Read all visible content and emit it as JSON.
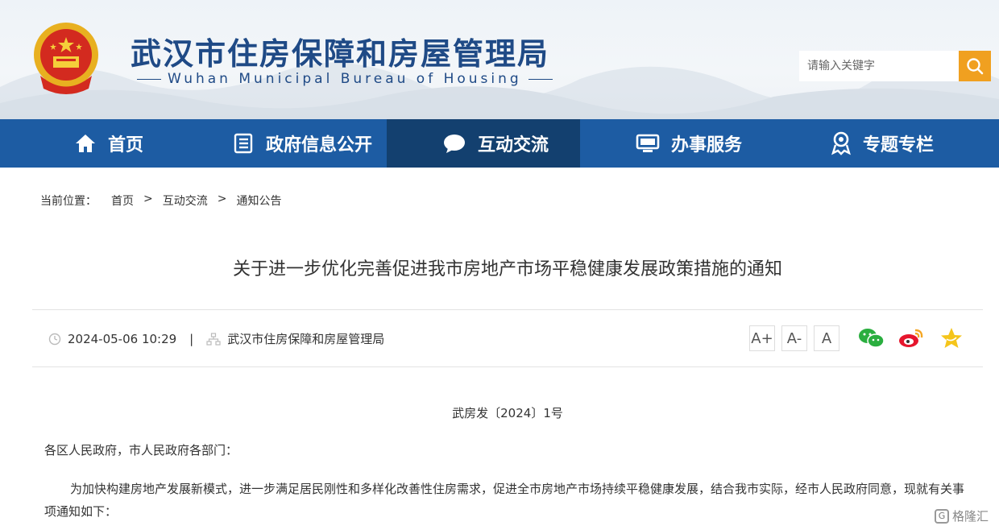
{
  "header": {
    "title": "武汉市住房保障和房屋管理局",
    "subtitle": "Wuhan Municipal Bureau of Housing",
    "search_placeholder": "请输入关键字"
  },
  "nav": {
    "items": [
      {
        "label": "首页",
        "icon": "home-icon"
      },
      {
        "label": "政府信息公开",
        "icon": "document-list-icon"
      },
      {
        "label": "互动交流",
        "icon": "chat-bubble-icon",
        "active": true
      },
      {
        "label": "办事服务",
        "icon": "monitor-icon"
      },
      {
        "label": "专题专栏",
        "icon": "location-pin-icon"
      }
    ]
  },
  "breadcrumb": {
    "prefix": "当前位置：",
    "items": [
      "首页",
      "互动交流",
      "通知公告"
    ],
    "separator": ">"
  },
  "article": {
    "title": "关于进一步优化完善促进我市房地产市场平稳健康发展政策措施的通知",
    "date": "2024-05-06 10:29",
    "pipe": "|",
    "source": "武汉市住房保障和房屋管理局",
    "doc_number": "武房发〔2024〕1号",
    "salutation": "各区人民政府，市人民政府各部门：",
    "body_para": "为加快构建房地产发展新模式，进一步满足居民刚性和多样化改善性住房需求，促进全市房地产市场持续平稳健康发展，结合我市实际，经市人民政府同意，现就有关事项通知如下："
  },
  "font_controls": [
    "A+",
    "A-",
    "A"
  ],
  "share_icons": [
    "wechat-icon",
    "weibo-icon",
    "favorite-star-icon"
  ],
  "watermark": "格隆汇",
  "colors": {
    "nav_bg": "#1d5ca3",
    "nav_active": "#13406f",
    "title_blue": "#1f4a86",
    "search_btn": "#f0a020"
  }
}
